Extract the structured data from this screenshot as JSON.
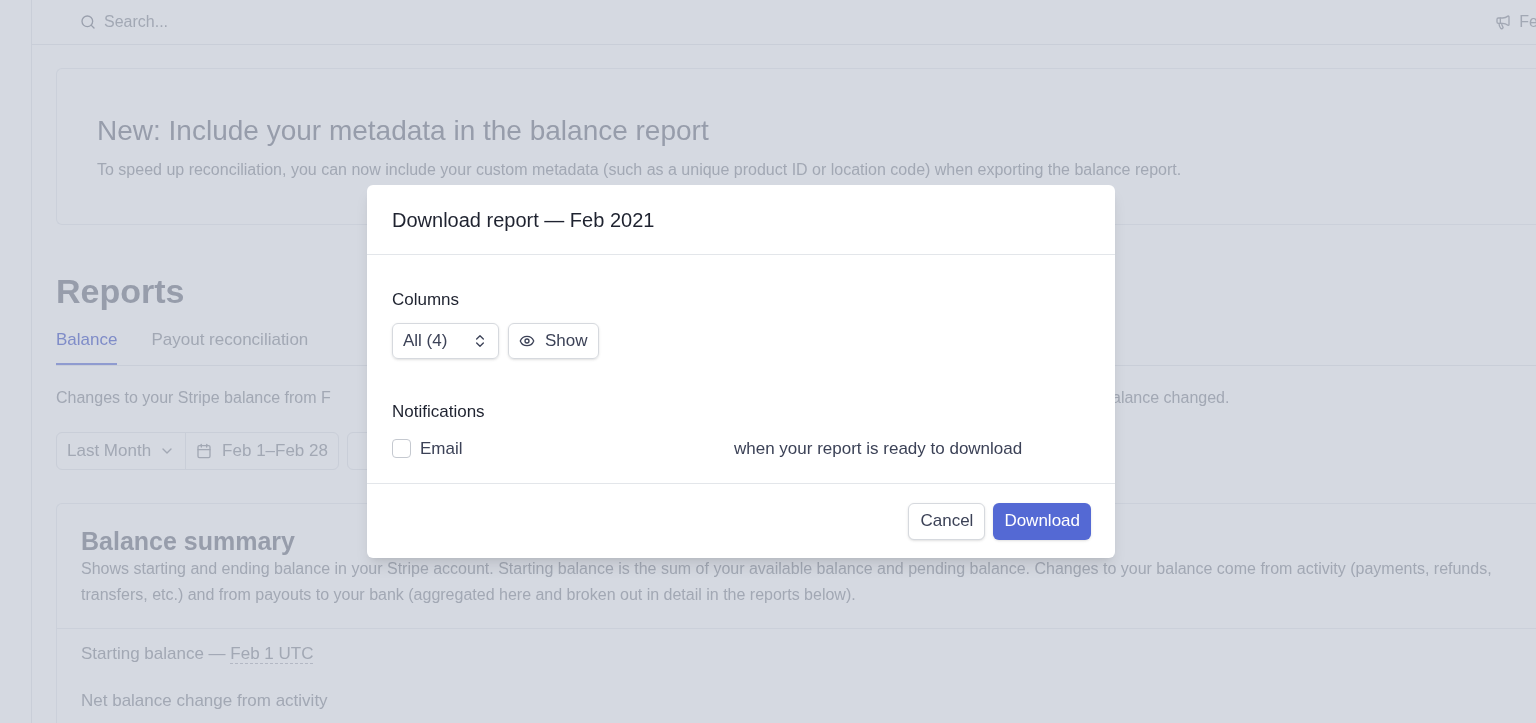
{
  "topbar": {
    "search_placeholder": "Search...",
    "feedback_label": "Fe"
  },
  "banner": {
    "title": "New: Include your metadata in the balance report",
    "text": "To speed up reconciliation, you can now include your custom metadata (such as a unique product ID or location code) when exporting the balance report."
  },
  "page": {
    "title": "Reports",
    "tabs": [
      {
        "label": "Balance",
        "selected": true
      },
      {
        "label": "Payout reconciliation",
        "selected": false
      }
    ],
    "description_left": "Changes to your Stripe balance from F",
    "description_right": "alance changed.",
    "period_select": "Last Month",
    "date_range": "Feb 1–Feb 28"
  },
  "summary": {
    "title": "Balance summary",
    "text": "Shows starting and ending balance in your Stripe account. Starting balance is the sum of your available balance and pending balance. Changes to your balance come from activity (payments, refunds, transfers, etc.) and from payouts to your bank (aggregated here and broken out in detail in the reports below).",
    "rows": [
      {
        "label": "Starting balance — ",
        "date": "Feb 1 UTC"
      },
      {
        "label": "Net balance change from activity"
      }
    ]
  },
  "dialog": {
    "title": "Download report — Feb 2021",
    "columns_label": "Columns",
    "columns_select": "All (4)",
    "show_button": "Show",
    "notifications_label": "Notifications",
    "email": {
      "label": "Email",
      "checked": false,
      "hint": "when your report is ready to download"
    },
    "buttons": [
      {
        "label": "Cancel",
        "kind": "secondary"
      },
      {
        "label": "Download",
        "kind": "primary"
      }
    ]
  }
}
